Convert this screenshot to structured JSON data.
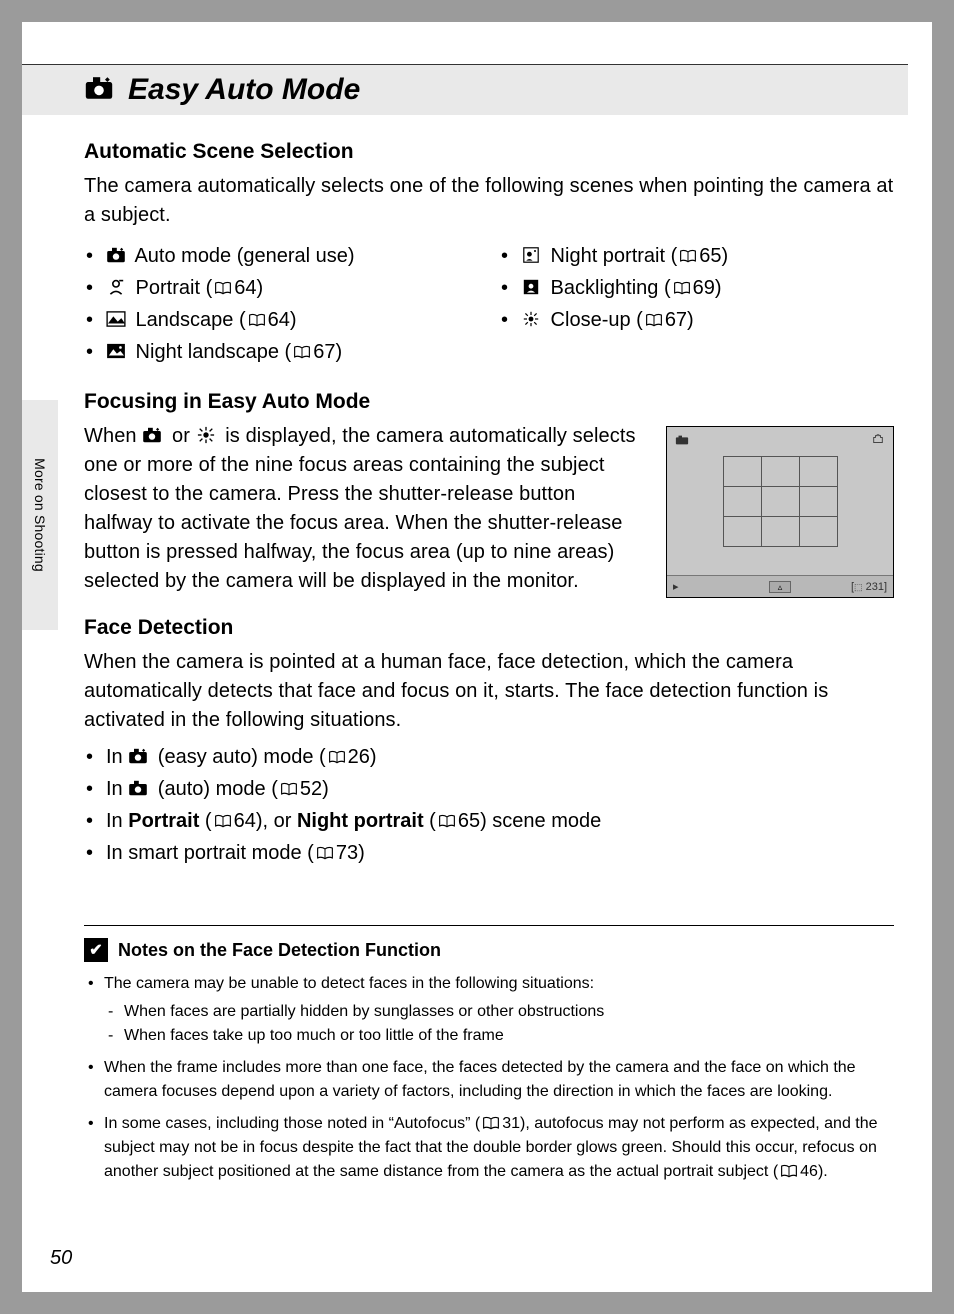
{
  "page_title": "Easy Auto Mode",
  "side_tab": "More on Shooting",
  "page_number": "50",
  "section1": {
    "heading": "Automatic Scene Selection",
    "intro": "The camera automatically selects one of the following scenes when pointing the camera at a subject.",
    "col1": [
      {
        "icon": "camera-heart",
        "label": " Auto mode (general use)"
      },
      {
        "icon": "portrait",
        "label": " Portrait (",
        "ref": "64",
        "tail": ")"
      },
      {
        "icon": "landscape",
        "label": " Landscape (",
        "ref": "64",
        "tail": ")"
      },
      {
        "icon": "night-landscape",
        "label": " Night landscape (",
        "ref": "67",
        "tail": ")"
      }
    ],
    "col2": [
      {
        "icon": "night-portrait",
        "label": " Night portrait (",
        "ref": "65",
        "tail": ")"
      },
      {
        "icon": "backlighting",
        "label": " Backlighting (",
        "ref": "69",
        "tail": ")"
      },
      {
        "icon": "close-up",
        "label": " Close-up (",
        "ref": "67",
        "tail": ")"
      }
    ]
  },
  "section2": {
    "heading": "Focusing in Easy Auto Mode",
    "text_pre": "When ",
    "text_mid": " or ",
    "text_post": " is displayed, the camera automatically selects one or more of the nine focus areas containing the subject closest to the camera. Press the shutter-release button halfway to activate the focus area. When the shutter-release button is pressed halfway, the focus area (up to nine areas) selected by the camera will be displayed in the monitor.",
    "screen_bottom_right": "231"
  },
  "section3": {
    "heading": "Face Detection",
    "intro": "When the camera is pointed at a human face, face detection, which the camera automatically detects that face and focus on it, starts. The face detection function is activated in the following situations.",
    "items": [
      {
        "pre": "In ",
        "icon": "camera-heart",
        "post": " (easy auto) mode (",
        "ref": "26",
        "tail": ")"
      },
      {
        "pre": "In ",
        "icon": "camera",
        "post": " (auto) mode (",
        "ref": "52",
        "tail": ")"
      },
      {
        "pre": "In ",
        "bold1": "Portrait",
        "mid1": " (",
        "ref1": "64",
        "mid2": "), or ",
        "bold2": "Night portrait",
        "mid3": " (",
        "ref2": "65",
        "tail": ") scene mode"
      },
      {
        "pre": "In smart portrait mode (",
        "ref": "73",
        "tail": ")"
      }
    ]
  },
  "notes": {
    "heading": "Notes on the Face Detection Function",
    "items": [
      {
        "text": "The camera may be unable to detect faces in the following situations:",
        "sub": [
          "When faces are partially hidden by sunglasses or other obstructions",
          "When faces take up too much or too little of the frame"
        ]
      },
      {
        "text": "When the frame includes more than one face, the faces detected by the camera and the face on which the camera focuses depend upon a variety of factors, including the direction in which the faces are looking."
      },
      {
        "pre": "In some cases, including those noted in “Autofocus” (",
        "ref1": "31",
        "mid": "), autofocus may not perform as expected, and the subject may not be in focus despite the fact that the double border glows green. Should this occur, refocus on another subject positioned at the same distance from the camera as the actual portrait subject (",
        "ref2": "46",
        "tail": ")."
      }
    ]
  }
}
